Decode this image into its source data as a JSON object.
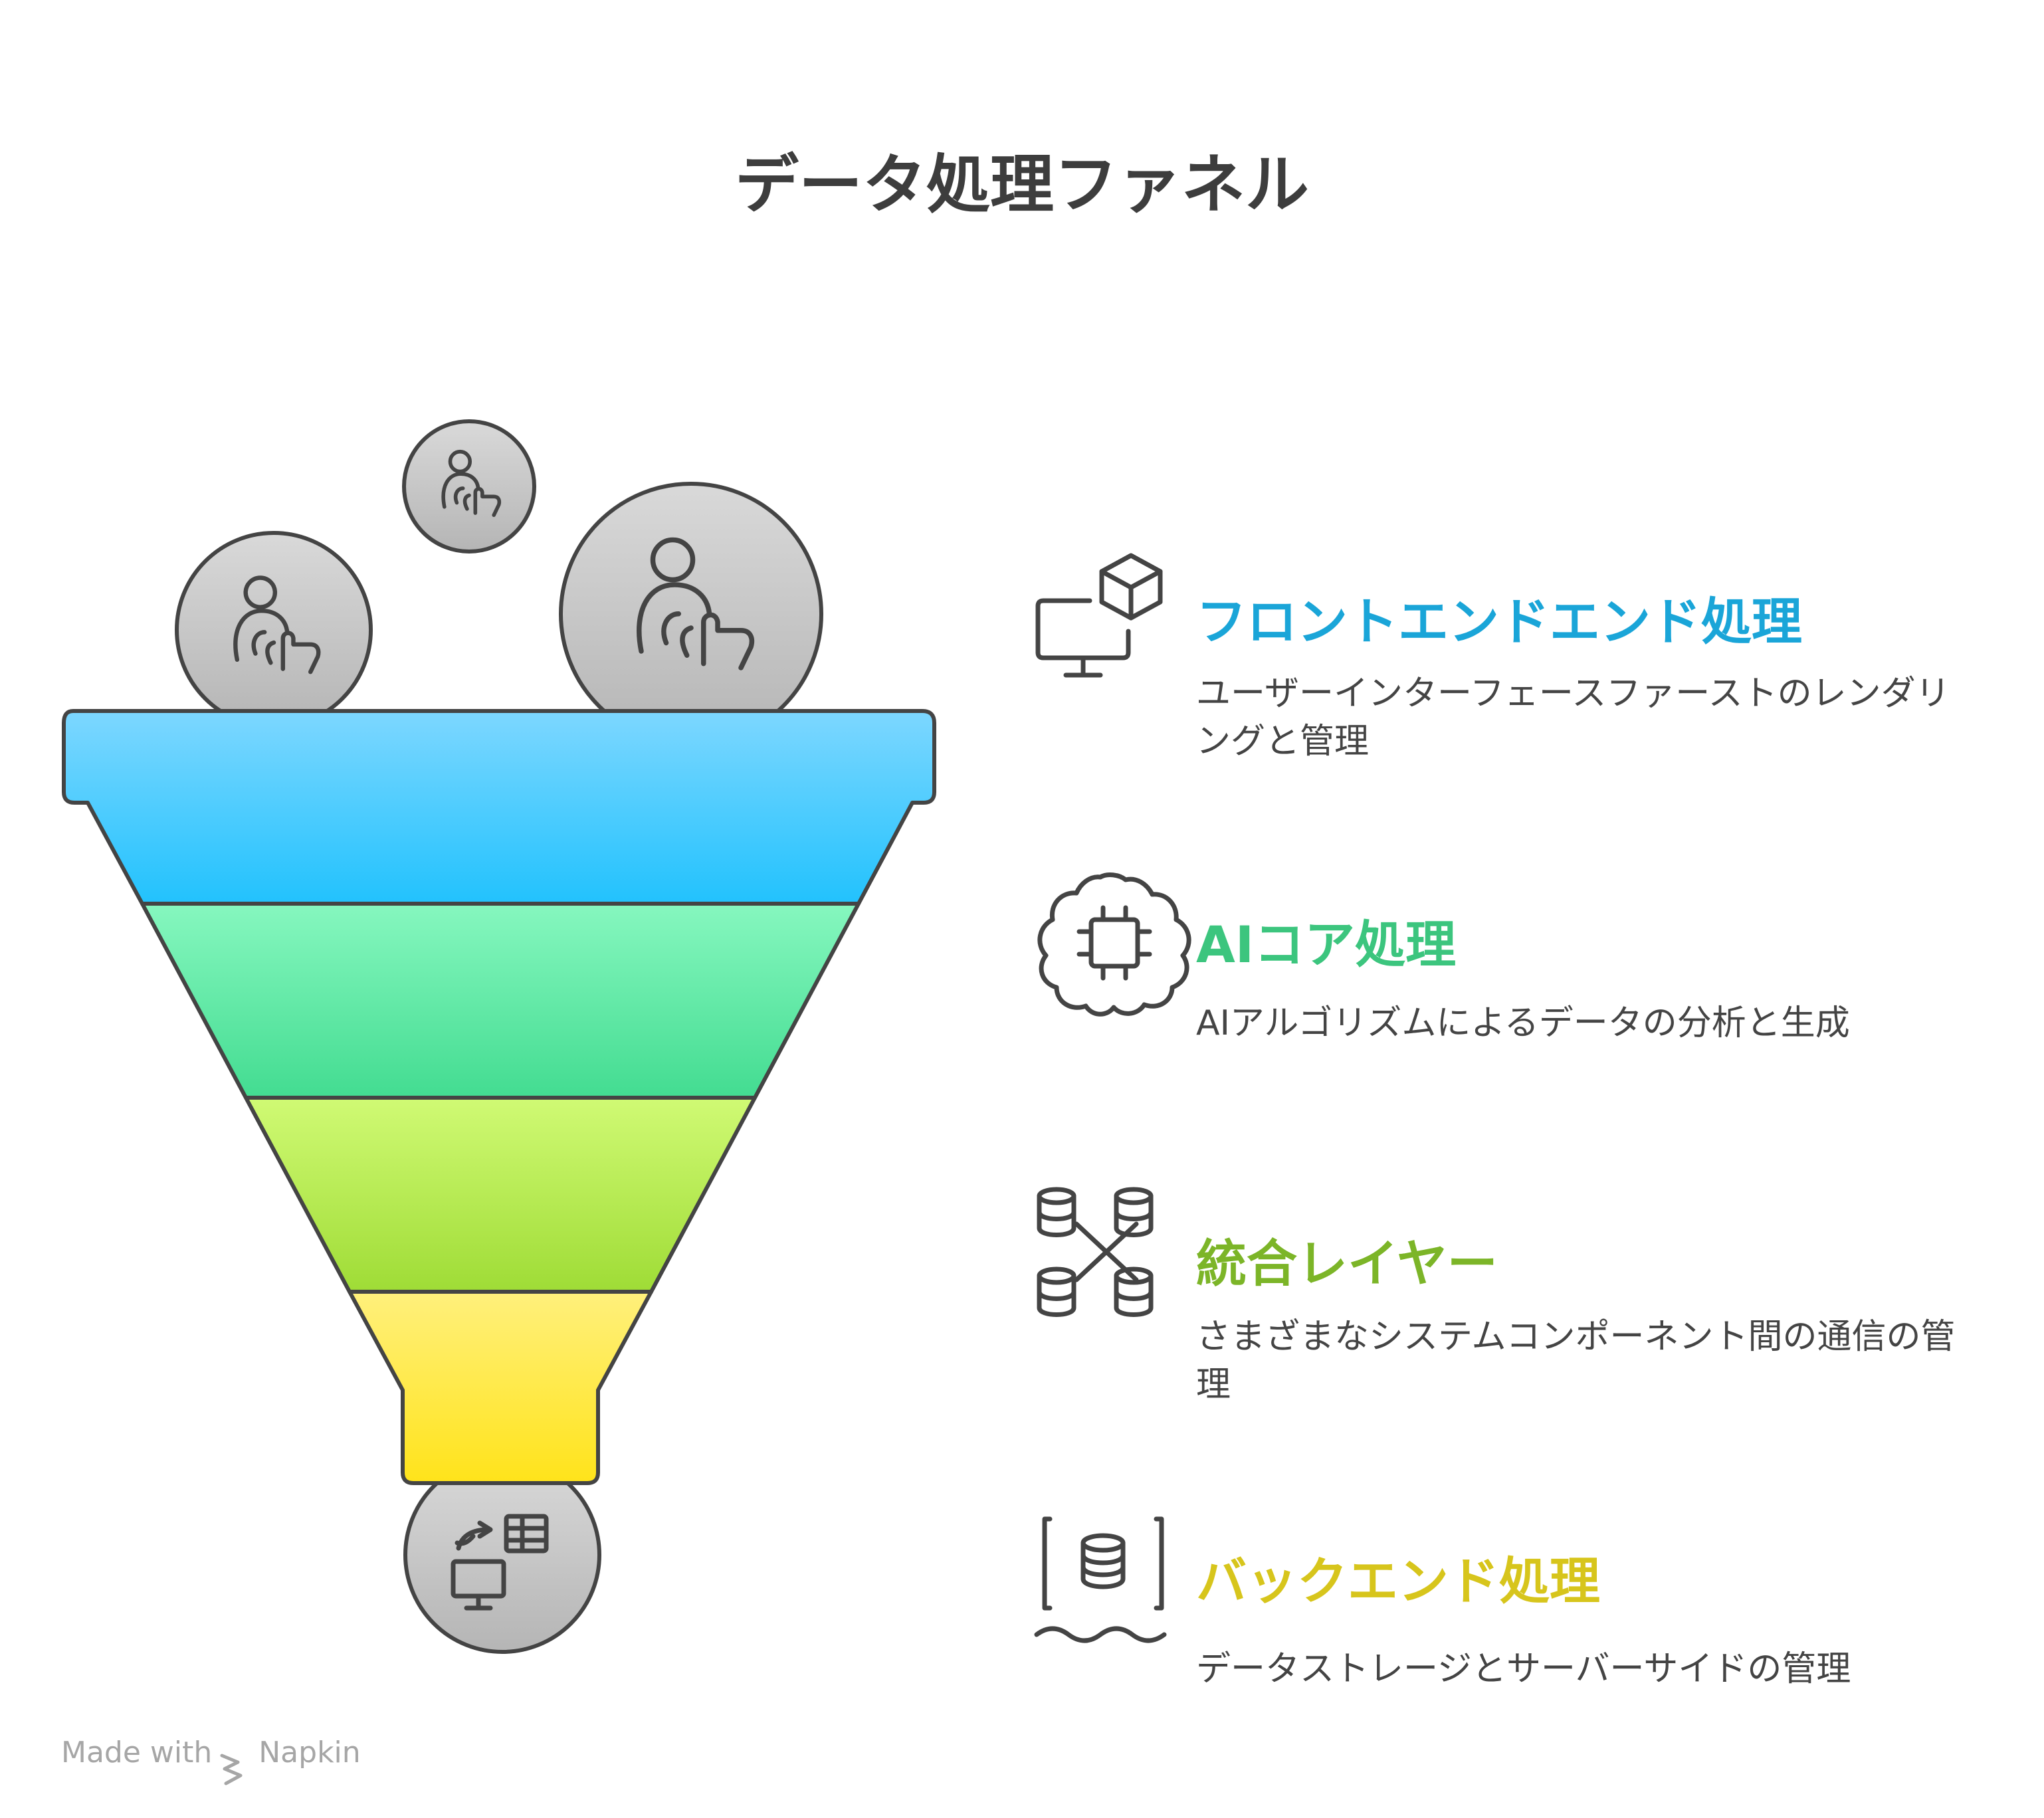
{
  "title": "データ処理ファネル",
  "colors": {
    "stroke": "#444444",
    "frontend": "#1aa5d8",
    "ai": "#3cc57e",
    "integration": "#7cb528",
    "backend": "#d7c51c",
    "funnel_blue": [
      "#7dd7ff",
      "#22c2fd"
    ],
    "funnel_green": [
      "#86f7bf",
      "#43dc91"
    ],
    "funnel_lime": [
      "#d0fa74",
      "#9fdc36"
    ],
    "funnel_yellow": [
      "#fff07c",
      "#ffe31a"
    ],
    "bubble": [
      "#d9d9d9",
      "#b5b5b5"
    ]
  },
  "stages": [
    {
      "title": "フロントエンドエンド処理",
      "description": "ユーザーインターフェースファーストのレンダリングと管理",
      "icon": "monitor-cube-icon"
    },
    {
      "title": "AIコア処理",
      "description": "AIアルゴリズムによるデータの分析と生成",
      "icon": "brain-chip-icon"
    },
    {
      "title": "統合レイヤー",
      "description": "さまざまなシステムコンポーネント間の通信の管理",
      "icon": "database-network-icon"
    },
    {
      "title": "バックエンド処理",
      "description": "データストレージとサーバーサイドの管理",
      "icon": "database-stream-icon"
    }
  ],
  "input_icons": [
    "user-touch-icon",
    "user-touch-icon",
    "user-touch-icon"
  ],
  "output_icon": "data-transfer-icon",
  "footer": {
    "made_with": "Made with",
    "brand": "Napkin"
  }
}
